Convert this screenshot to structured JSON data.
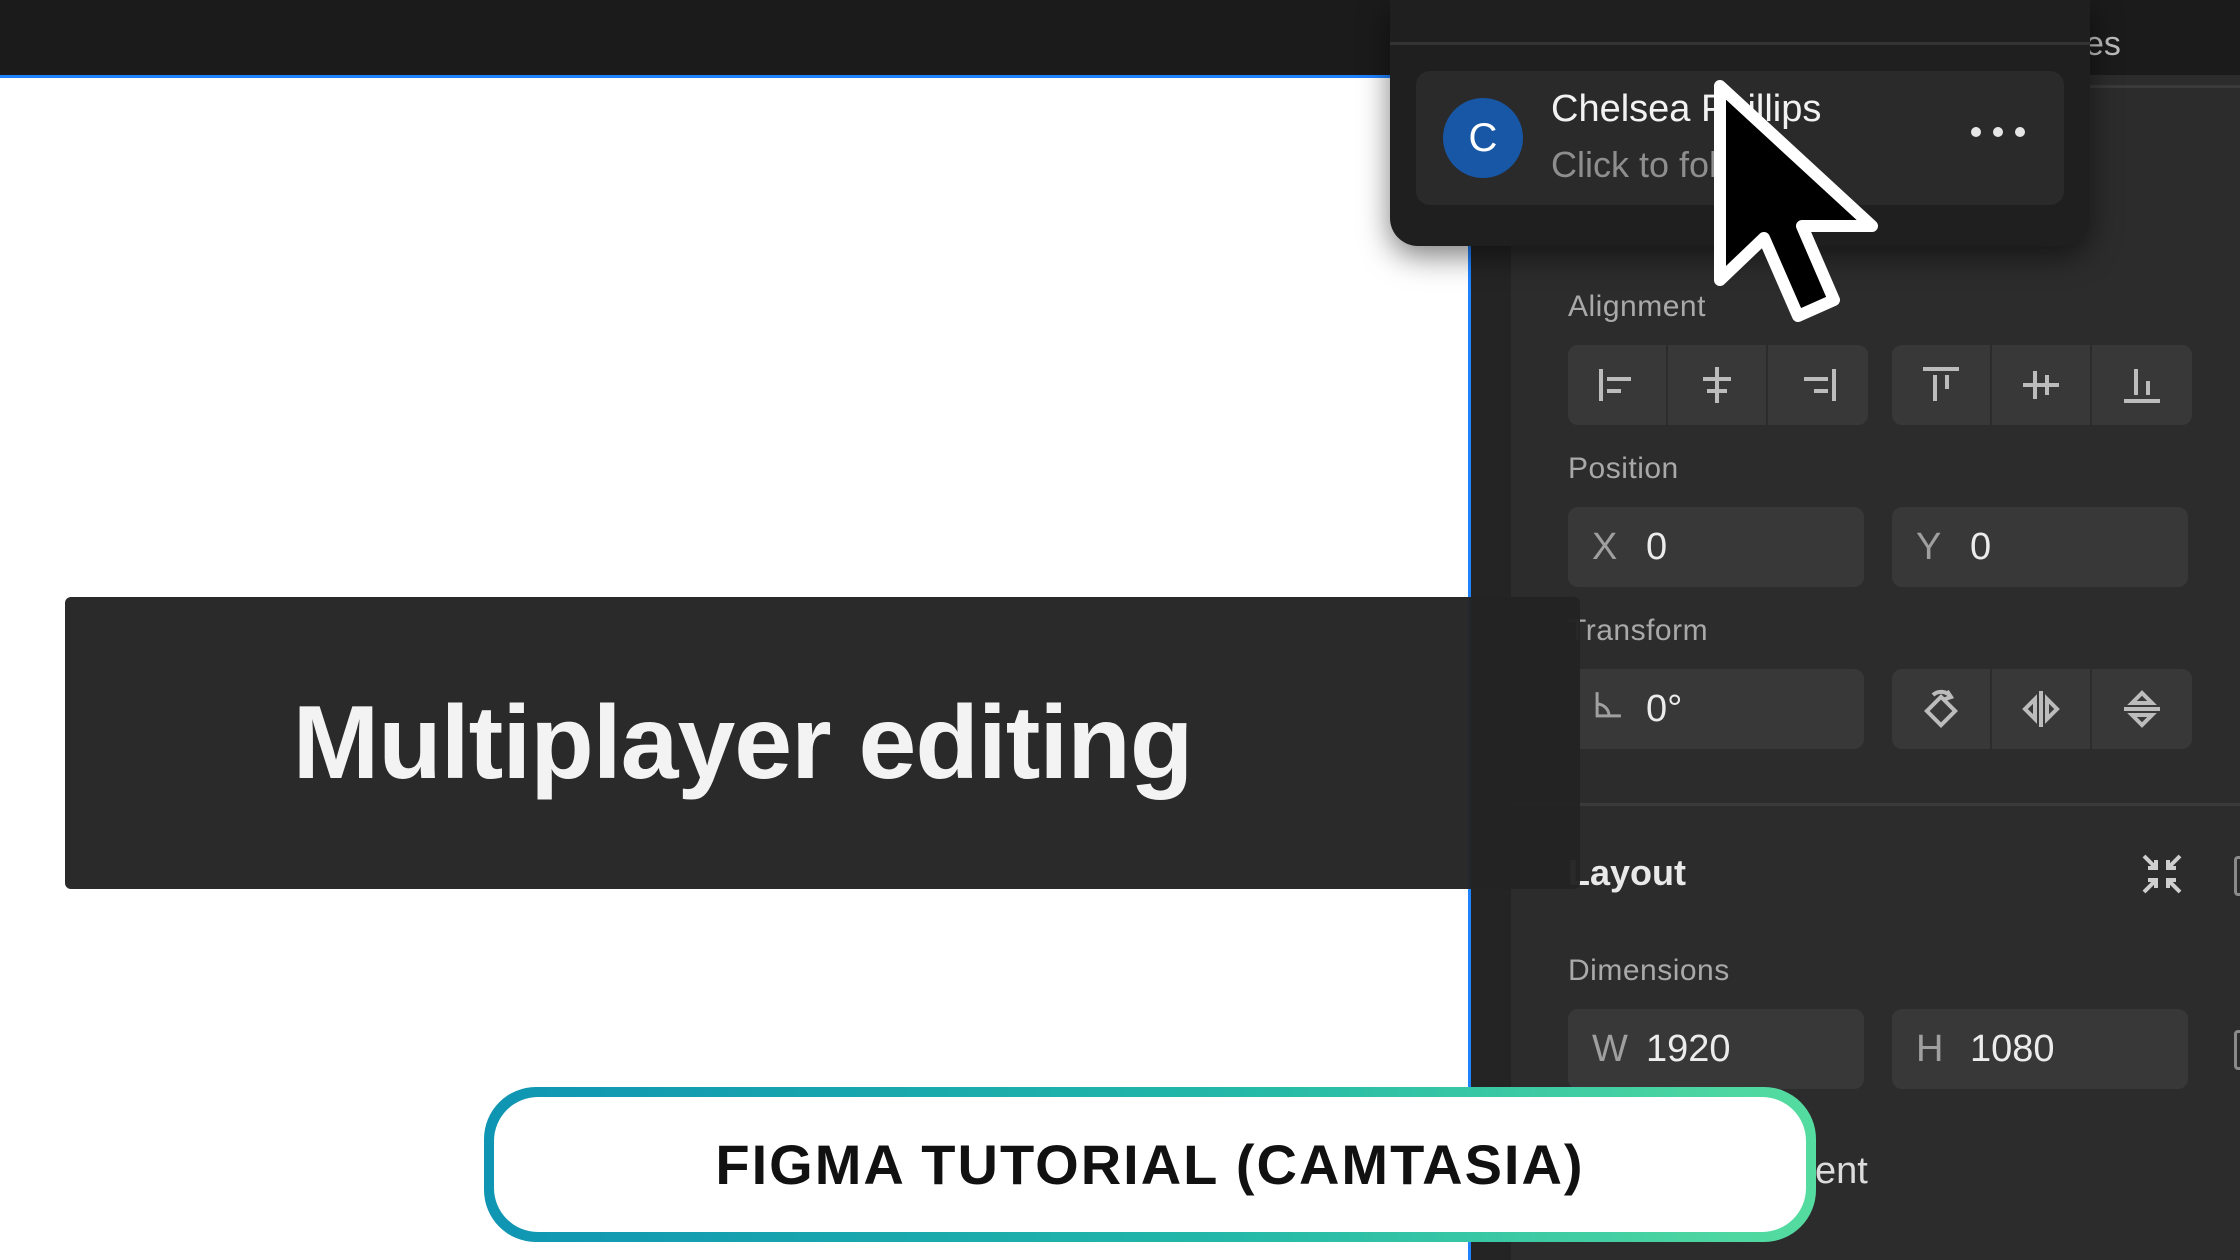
{
  "header": {
    "tab_partial": "es"
  },
  "presence_popup": {
    "avatar_initial": "C",
    "user_name": "Chelsea Phillips",
    "user_subtitle": "Click to follow",
    "more_icon": "ellipsis-icon",
    "avatar_color": "#1757a6"
  },
  "properties": {
    "alignment": {
      "label": "Alignment",
      "horizontal_icons": [
        "align-left-icon",
        "align-horizontal-center-icon",
        "align-right-icon"
      ],
      "vertical_icons": [
        "align-top-icon",
        "align-vertical-center-icon",
        "align-bottom-icon"
      ]
    },
    "position": {
      "label": "Position",
      "x_label": "X",
      "x_value": "0",
      "y_label": "Y",
      "y_value": "0"
    },
    "transform": {
      "label": "Transform",
      "rotation_value": "0°",
      "icons": [
        "rotate-icon",
        "flip-horizontal-icon",
        "flip-vertical-icon"
      ]
    },
    "layout": {
      "heading": "Layout",
      "collapse_icon": "collapse-icon"
    },
    "dimensions": {
      "label": "Dimensions",
      "w_label": "W",
      "w_value": "1920",
      "h_label": "H",
      "h_value": "1080"
    },
    "partial_label": "ent"
  },
  "overlay": {
    "title": "Multiplayer editing"
  },
  "caption": {
    "text": "FIGMA TUTORIAL (CAMTASIA)"
  },
  "colors": {
    "selection_blue": "#1f82ff",
    "panel_bg": "#2c2c2c",
    "caption_gradient_start": "#0f95b3",
    "caption_gradient_end": "#55dca0"
  }
}
